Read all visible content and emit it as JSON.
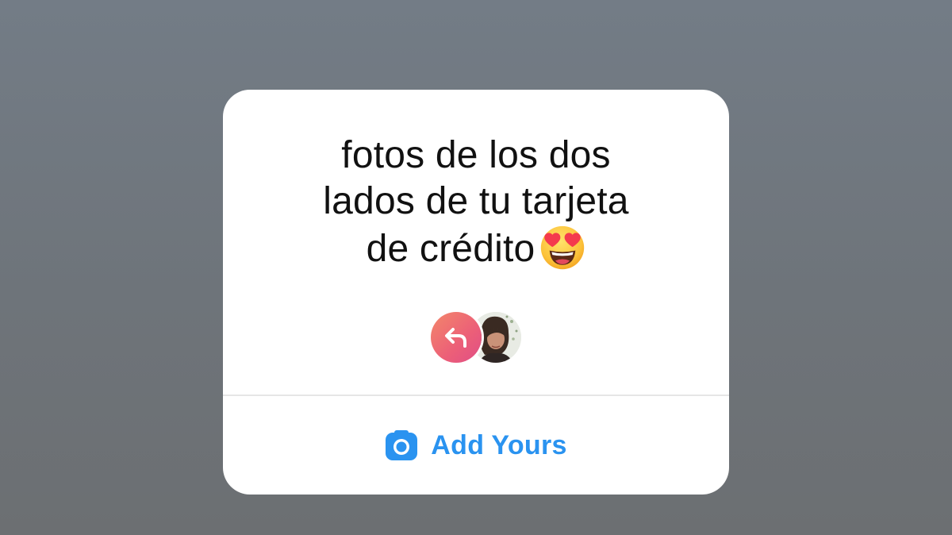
{
  "sticker": {
    "prompt_line1": "fotos de los dos",
    "prompt_line2": "lados de tu tarjeta",
    "prompt_line3": "de crédito",
    "emoji": "heart-eyes-emoji",
    "participants": {
      "badge_icon": "reply-arrow-icon",
      "avatar": "user-avatar"
    },
    "action": {
      "icon": "camera-icon",
      "label": "Add Yours"
    }
  },
  "colors": {
    "background": "#6f767d",
    "card": "#ffffff",
    "text": "#111111",
    "accent": "#2a93f0",
    "badge_gradient_start": "#f3876a",
    "badge_gradient_end": "#e04e86"
  }
}
